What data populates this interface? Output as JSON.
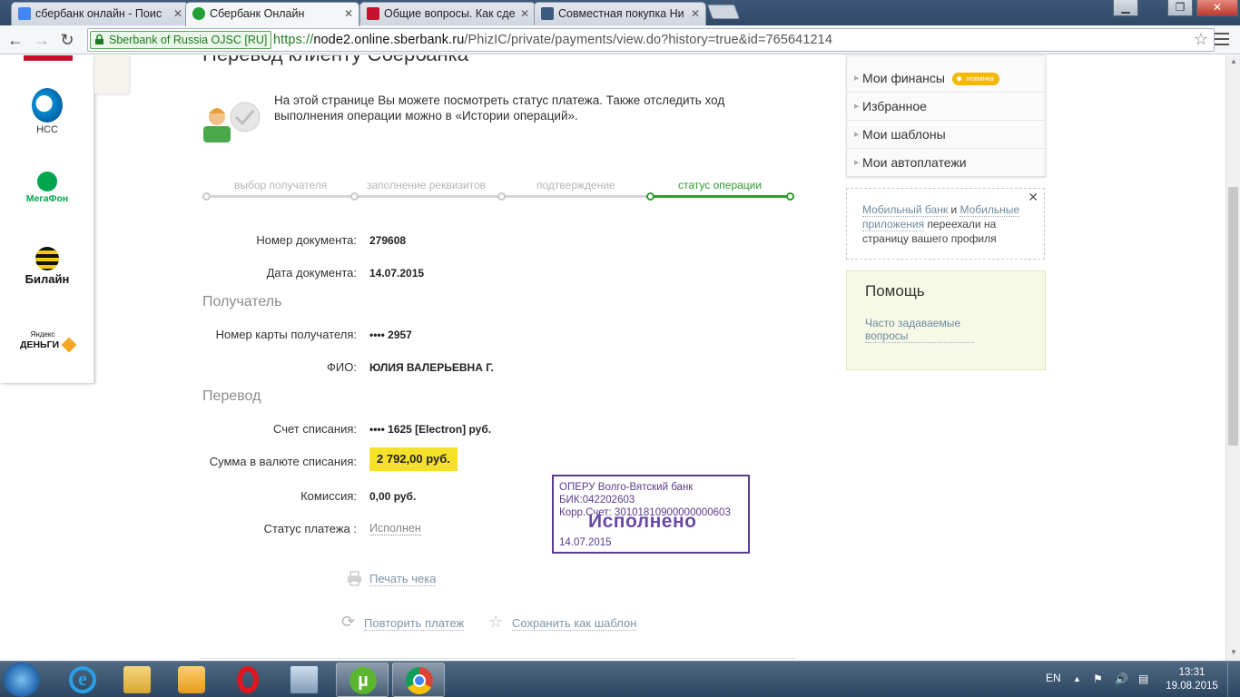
{
  "browser": {
    "tabs": [
      {
        "title": "сбербанк онлайн - Поис",
        "favicon_color": "#4285f4"
      },
      {
        "title": "Сбербанк Онлайн",
        "favicon_color": "#21a038"
      },
      {
        "title": "Общие вопросы. Как сде",
        "favicon_color": "#c8102e"
      },
      {
        "title": "Совместная покупка Ни",
        "favicon_color": "#3c5a80"
      }
    ],
    "window_buttons": {
      "minimize": "▁",
      "maximize": "❐",
      "close": "✕"
    },
    "ev_cert": "Sberbank of Russia  OJSC [RU]",
    "url": {
      "scheme": "https://",
      "host": "node2.online.sberbank.ru",
      "path": "/PhizIC/private/payments/view.do?history=true&id=765641214"
    },
    "nav": {
      "back": "←",
      "forward": "→",
      "reload": "↻"
    },
    "bookmark_star": "☆"
  },
  "left_panel": {
    "operators": [
      {
        "name": "НСС",
        "icon": "mts-logo-icon"
      },
      {
        "name": "МегаФон",
        "icon": "megafon-logo-icon"
      },
      {
        "name": "Билайн",
        "icon": "beeline-logo-icon"
      },
      {
        "name_line1": "Яндекс",
        "name_line2": "ДЕНЬГИ",
        "icon": "yandex-money-logo-icon"
      }
    ]
  },
  "page": {
    "title": "Перевод клиенту Сбербанка",
    "intro": "На этой странице Вы можете посмотреть статус платежа. Также отследить ход выполнения операции можно в «Истории операций».",
    "steps": [
      {
        "label": "выбор получателя",
        "active": false
      },
      {
        "label": "заполнение реквизитов",
        "active": false
      },
      {
        "label": "подтверждение",
        "active": false
      },
      {
        "label": "статус операции",
        "active": true
      }
    ],
    "document": {
      "number_label": "Номер документа:",
      "number": "279608",
      "date_label": "Дата документа:",
      "date": "14.07.2015"
    },
    "recipient": {
      "section_title": "Получатель",
      "card_label": "Номер карты получателя:",
      "card": "•••• 2957",
      "name_label": "ФИО:",
      "name": "ЮЛИЯ ВАЛЕРЬЕВНА Г."
    },
    "transfer": {
      "section_title": "Перевод",
      "account_label": "Счет списания:",
      "account": "•••• 1625  [Electron]  руб.",
      "amount_label": "Сумма в валюте списания:",
      "amount": "2 792,00  руб.",
      "fee_label": "Комиссия:",
      "fee": "0,00 руб.",
      "status_label": "Статус платежа :",
      "status": "Исполнен"
    },
    "stamp": {
      "bank": "ОПЕРУ Волго-Вятский банк",
      "bik": "БИК:042202603",
      "corr": "Корр.Счет: 30101810900000000603",
      "big": "Исполнено",
      "date": "14.07.2015"
    },
    "actions": {
      "print": "Печать чека",
      "repeat": "Повторить платеж",
      "save_template": "Сохранить как шаблон"
    }
  },
  "right": {
    "menu": [
      {
        "label": "Мои финансы",
        "badge": "новинка"
      },
      {
        "label": "Избранное"
      },
      {
        "label": "Мои шаблоны"
      },
      {
        "label": "Мои автоплатежи"
      }
    ],
    "notice": {
      "link1": "Мобильный банк",
      "and": "и",
      "link2": "Мобильные приложения",
      "text": "переехали на страницу вашего профиля",
      "close": "✕"
    },
    "help": {
      "title": "Помощь",
      "link": "Часто задаваемые вопросы"
    }
  },
  "taskbar": {
    "language": "EN",
    "time": "13:31",
    "date": "19.08.2015"
  }
}
